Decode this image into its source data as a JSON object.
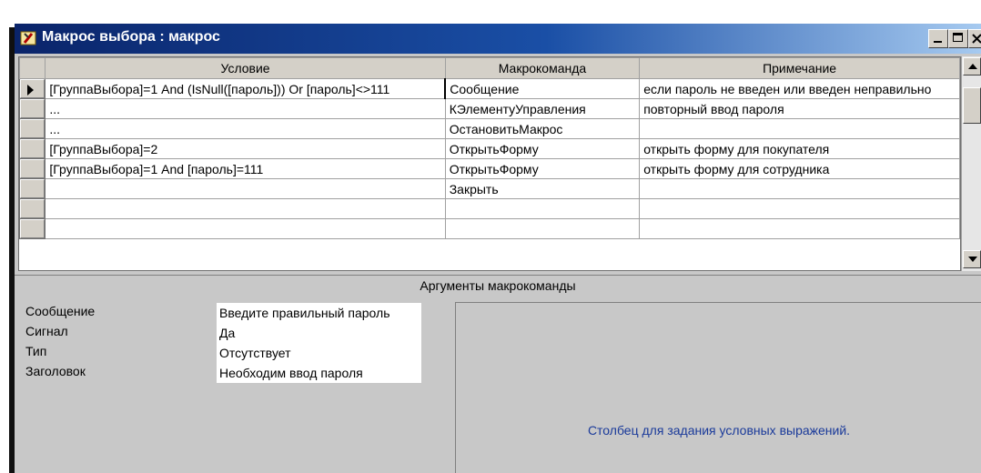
{
  "window": {
    "title": "Макрос выбора : макрос",
    "buttons": [
      "minimize-button",
      "maximize-button",
      "close-button"
    ]
  },
  "grid": {
    "headers": [
      "Условие",
      "Макрокоманда",
      "Примечание"
    ],
    "rows": [
      {
        "condition": "[ГруппаВыбора]=1 And (IsNull([пароль])) Or [пароль]<>111",
        "action": "Сообщение",
        "note": "если пароль не введен или введен неправильно"
      },
      {
        "condition": "...",
        "action": "КЭлементуУправления",
        "note": "повторный ввод пароля"
      },
      {
        "condition": "...",
        "action": "ОстановитьМакрос",
        "note": ""
      },
      {
        "condition": "[ГруппаВыбора]=2",
        "action": "ОткрытьФорму",
        "note": "открыть форму для покупателя"
      },
      {
        "condition": "[ГруппаВыбора]=1 And [пароль]=111",
        "action": "ОткрытьФорму",
        "note": "открыть форму для сотрудника"
      },
      {
        "condition": "",
        "action": "Закрыть",
        "note": ""
      },
      {
        "condition": "",
        "action": "",
        "note": ""
      }
    ]
  },
  "arguments": {
    "header": "Аргументы макрокоманды",
    "fields": [
      {
        "label": "Сообщение",
        "value": "Введите правильный пароль"
      },
      {
        "label": "Сигнал",
        "value": "Да"
      },
      {
        "label": "Тип",
        "value": "Отсутствует"
      },
      {
        "label": "Заголовок",
        "value": "Необходим  ввод пароля"
      }
    ],
    "hint": "Столбец для задания условных выражений."
  },
  "colors": {
    "titlebar_start": "#0a246a",
    "titlebar_end": "#a6caf0",
    "hint_text": "#1a3a9a"
  },
  "icons": {
    "title": "macro-icon",
    "selector": "row-selector-arrow-icon"
  }
}
